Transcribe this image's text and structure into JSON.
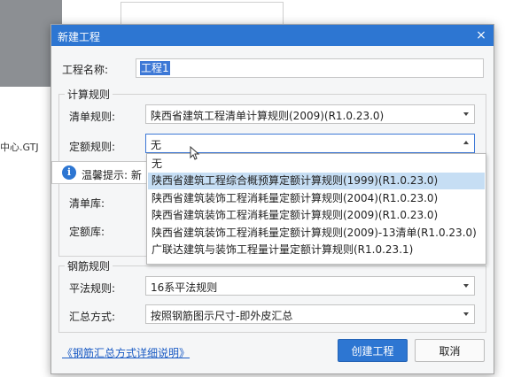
{
  "background": {
    "filename_fragment": "中心.GTJ"
  },
  "dialog": {
    "title": "新建工程",
    "close_glyph": "×",
    "project_name_label": "工程名称:",
    "project_name_value": "工程1",
    "calc_rules": {
      "legend": "计算规则",
      "bill_rule_label": "清单规则:",
      "bill_rule_value": "陕西省建筑工程清单计算规则(2009)(R1.0.23.0)",
      "quota_rule_label": "定额规则:",
      "quota_rule_value": "无",
      "tip_label": "温馨提示:",
      "tip_text_visible": "新",
      "bill_lib_label": "清单库:",
      "quota_lib_label": "定额库:"
    },
    "quota_dropdown": {
      "options": [
        "无",
        "陕西省建筑工程综合概预算定额计算规则(1999)(R1.0.23.0)",
        "陕西省建筑装饰工程消耗量定额计算规则(2004)(R1.0.23.0)",
        "陕西省建筑装饰工程消耗量定额计算规则(2009)(R1.0.23.0)",
        "陕西省建筑装饰工程消耗量定额计算规则(2009)-13清单(R1.0.23.0)",
        "广联达建筑与装饰工程量计量定额计算规则(R1.0.23.1)"
      ],
      "highlighted_index": 1
    },
    "rebar_rules": {
      "legend": "钢筋规则",
      "flat_rule_label": "平法规则:",
      "flat_rule_value": "16系平法规则",
      "summary_label": "汇总方式:",
      "summary_value": "按照钢筋图示尺寸-即外皮汇总"
    },
    "help_link": "《钢筋汇总方式详细说明》",
    "create_button": "创建工程",
    "cancel_button": "取消"
  },
  "colors": {
    "titlebar": "#2d76d2",
    "primary_button": "#2d76d2",
    "highlight": "#c6def4",
    "link": "#1a5bc4"
  }
}
